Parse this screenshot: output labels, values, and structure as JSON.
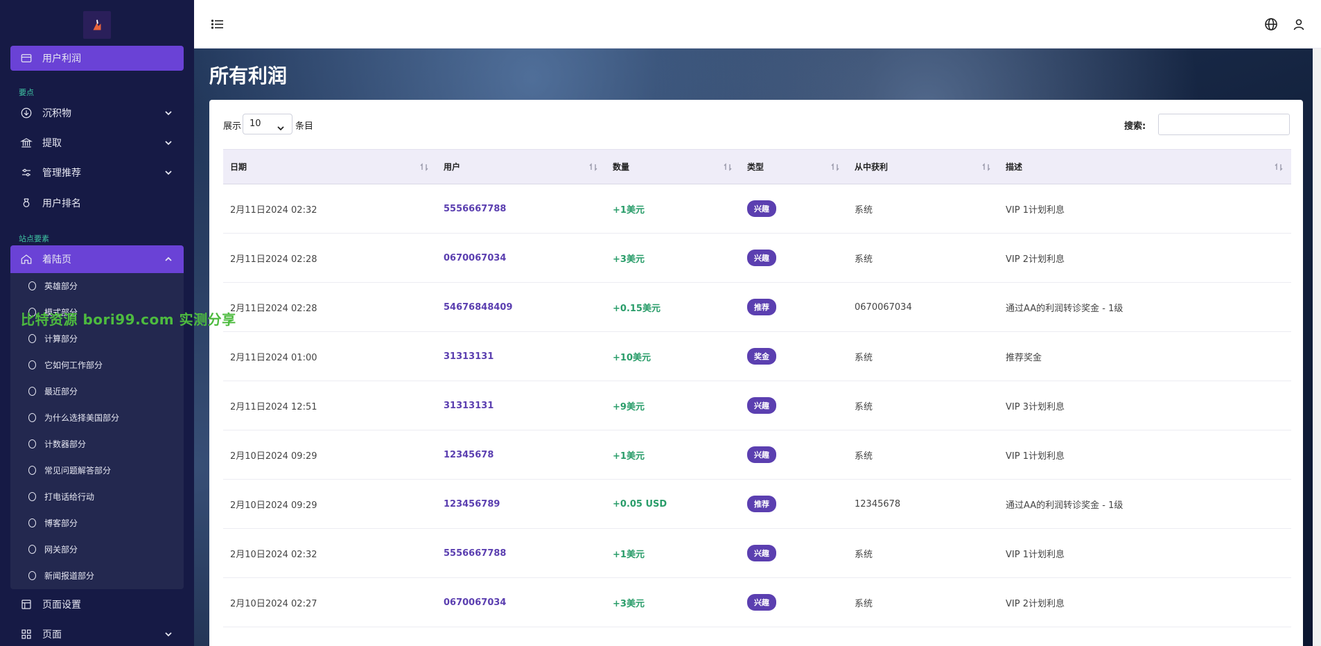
{
  "sidebar": {
    "sections": {
      "essentials": "要点",
      "site_elements": "站点要素"
    },
    "items": [
      {
        "label": "用户利润",
        "icon": "card-icon"
      },
      {
        "label": "沉积物",
        "icon": "deposit-icon"
      },
      {
        "label": "提取",
        "icon": "bank-icon"
      },
      {
        "label": "管理推荐",
        "icon": "sliders-icon"
      },
      {
        "label": "用户排名",
        "icon": "award-icon"
      },
      {
        "label": "着陆页",
        "icon": "home-icon"
      },
      {
        "label": "页面设置",
        "icon": "layout-icon"
      },
      {
        "label": "页面",
        "icon": "grid-icon"
      }
    ],
    "sub_items": [
      "英雄部分",
      "模式部分",
      "计算部分",
      "它如何工作部分",
      "最近部分",
      "为什么选择美国部分",
      "计数器部分",
      "常见问题解答部分",
      "打电话给行动",
      "博客部分",
      "网关部分",
      "新闻报道部分"
    ]
  },
  "watermark": "比特资源 bori99.com 实测分享",
  "page": {
    "title": "所有利润",
    "show_label": "展示",
    "page_length": "10",
    "entries_label": "条目",
    "search_label": "搜索:"
  },
  "table": {
    "headers": [
      "日期",
      "用户",
      "数量",
      "类型",
      "从中获利",
      "描述"
    ],
    "rows": [
      {
        "date": "2月11日2024 02:32",
        "user": "5556667788",
        "amount": "+1美元",
        "type": "兴趣",
        "from": "系统",
        "desc": "VIP 1计划利息"
      },
      {
        "date": "2月11日2024 02:28",
        "user": "0670067034",
        "amount": "+3美元",
        "type": "兴趣",
        "from": "系统",
        "desc": "VIP 2计划利息"
      },
      {
        "date": "2月11日2024 02:28",
        "user": "54676848409",
        "amount": "+0.15美元",
        "type": "推荐",
        "from": "0670067034",
        "desc": "通过AA的利润转诊奖金 - 1级"
      },
      {
        "date": "2月11日2024 01:00",
        "user": "31313131",
        "amount": "+10美元",
        "type": "奖金",
        "from": "系统",
        "desc": "推荐奖金"
      },
      {
        "date": "2月11日2024 12:51",
        "user": "31313131",
        "amount": "+9美元",
        "type": "兴趣",
        "from": "系统",
        "desc": "VIP 3计划利息"
      },
      {
        "date": "2月10日2024 09:29",
        "user": "12345678",
        "amount": "+1美元",
        "type": "兴趣",
        "from": "系统",
        "desc": "VIP 1计划利息"
      },
      {
        "date": "2月10日2024 09:29",
        "user": "123456789",
        "amount": "+0.05 USD",
        "type": "推荐",
        "from": "12345678",
        "desc": "通过AA的利润转诊奖金 - 1级"
      },
      {
        "date": "2月10日2024 02:32",
        "user": "5556667788",
        "amount": "+1美元",
        "type": "兴趣",
        "from": "系统",
        "desc": "VIP 1计划利息"
      },
      {
        "date": "2月10日2024 02:27",
        "user": "0670067034",
        "amount": "+3美元",
        "type": "兴趣",
        "from": "系统",
        "desc": "VIP 2计划利息"
      }
    ]
  },
  "colors": {
    "accent": "#6a42d6",
    "sidebar_bg": "#161a45",
    "badge": "#5b3fb0",
    "amount": "#2a9d6a",
    "section_label": "#3fc5a3"
  }
}
